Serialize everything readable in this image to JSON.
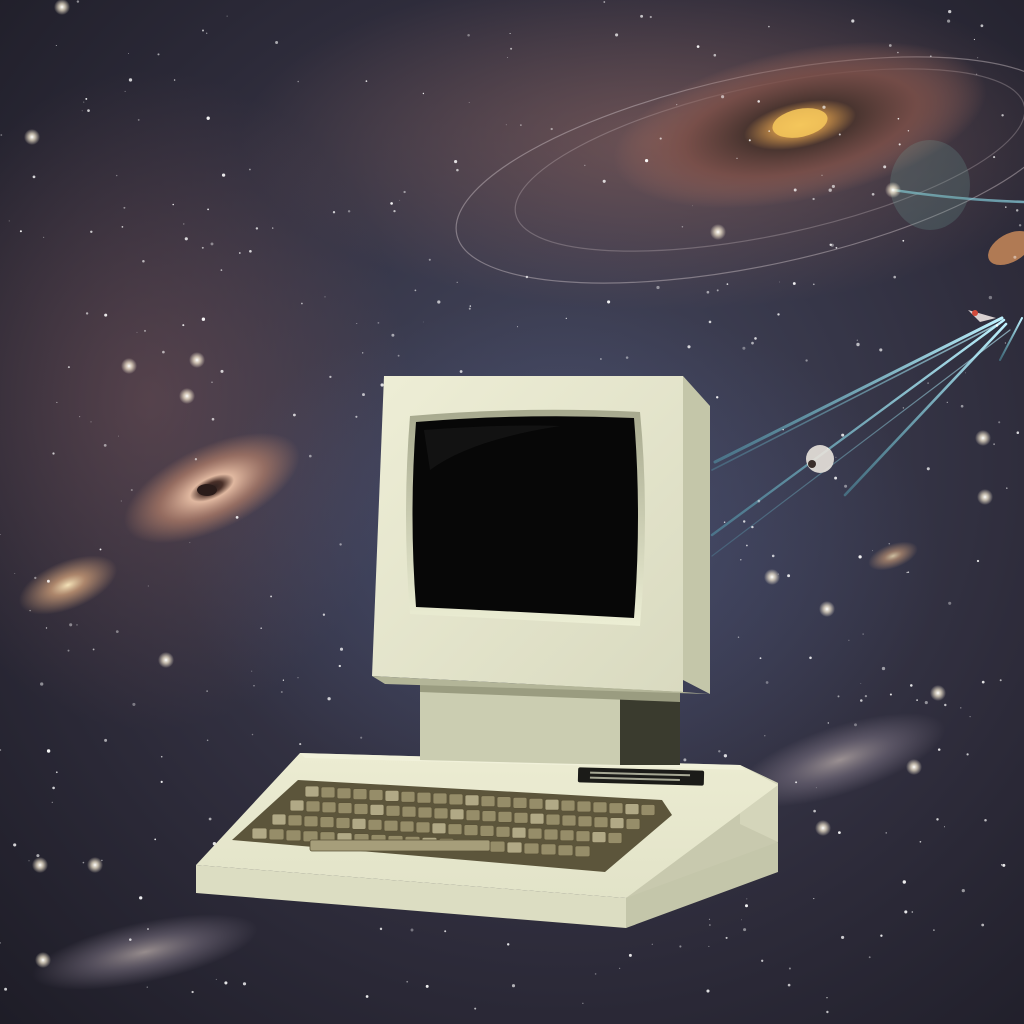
{
  "scene": {
    "colors": {
      "space_deep": "#1d1b27",
      "space_mid": "#3a3646",
      "space_blue": "#3e4560",
      "nebula_pink": "#8a5e5c",
      "nebula_orange": "#c98a5c",
      "galaxy_core": "#f2c65a",
      "trail_cyan": "#7fd7e6",
      "computer_beige": "#e6e6cc",
      "computer_shadow": "#a9ab8e",
      "screen_black": "#070707",
      "key_olive": "#8f8662"
    },
    "icons": [
      "retro-computer",
      "crt-monitor",
      "keyboard",
      "spiral-galaxy",
      "comet",
      "spaceship",
      "star"
    ]
  }
}
